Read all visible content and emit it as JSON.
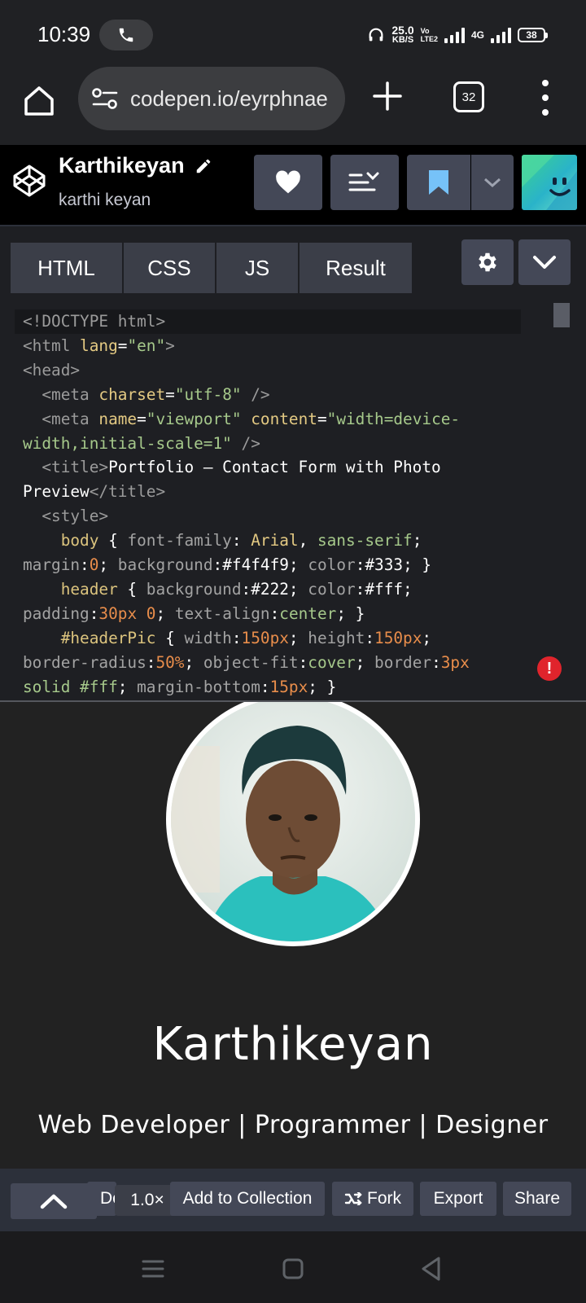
{
  "status_bar": {
    "time": "10:39",
    "net_speed_value": "25.0",
    "net_speed_unit": "KB/S",
    "volte_top": "Vo",
    "volte_bottom": "LTE2",
    "network": "4G",
    "battery": "38"
  },
  "browser": {
    "url": "codepen.io/eyrphnae",
    "tab_count": "32",
    "icons": [
      "home-icon",
      "site-settings-icon",
      "plus-icon",
      "tabs-icon",
      "more-vert-icon"
    ]
  },
  "pen": {
    "title": "Karthikeyan",
    "author": "karthi keyan"
  },
  "editor": {
    "tabs": [
      "HTML",
      "CSS",
      "JS",
      "Result"
    ],
    "code": {
      "l1": "<!DOCTYPE html>",
      "l2_open": "<html ",
      "l2_attr": "lang",
      "l2_eq": "=",
      "l2_val": "\"en\"",
      "l2_close": ">",
      "l3": "<head>",
      "l4_open": "  <meta ",
      "l4_attr": "charset",
      "l4_eq": "=",
      "l4_val": "\"utf-8\"",
      "l4_close": " />",
      "l5_open": "  <meta ",
      "l5_attr1": "name",
      "l5_eq1": "=",
      "l5_val1": "\"viewport\"",
      "l5_sp": " ",
      "l5_attr2": "content",
      "l5_eq2": "=",
      "l5_val2": "\"width=device-",
      "l6_val": "width,initial-scale=1\"",
      "l6_close": " />",
      "l7_open": "  <title>",
      "l7_text": "Portfolio — Contact Form with Photo",
      "l8_text": "Preview",
      "l8_close": "</title>",
      "l9": "  <style>",
      "l10_sel": "    body",
      "l10_a": " { ",
      "l10_prop": "font-family",
      "l10_b": ": ",
      "l10_v1": "Arial",
      "l10_c": ", ",
      "l10_v2": "sans-serif",
      "l10_d": ";",
      "l11_prop1": "margin",
      "l11_a": ":",
      "l11_num1": "0",
      "l11_b": "; ",
      "l11_prop2": "background",
      "l11_c": ":",
      "l11_v2": "#f4f4f9",
      "l11_d": "; ",
      "l11_prop3": "color",
      "l11_e": ":",
      "l11_v3": "#333",
      "l11_f": "; }",
      "l12_sel": "    header",
      "l12_a": " { ",
      "l12_prop1": "background",
      "l12_b": ":",
      "l12_v1": "#222",
      "l12_c": "; ",
      "l12_prop2": "color",
      "l12_d": ":",
      "l12_v2": "#fff",
      "l12_e": ";",
      "l13_prop1": "padding",
      "l13_a": ":",
      "l13_num1": "30px 0",
      "l13_b": "; ",
      "l13_prop2": "text-align",
      "l13_c": ":",
      "l13_v2": "center",
      "l13_d": "; }",
      "l14_sel": "    #headerPic",
      "l14_a": " { ",
      "l14_prop1": "width",
      "l14_b": ":",
      "l14_num1": "150px",
      "l14_c": "; ",
      "l14_prop2": "height",
      "l14_d": ":",
      "l14_num2": "150px",
      "l14_e": ";",
      "l15_prop1": "border-radius",
      "l15_a": ":",
      "l15_num1": "50%",
      "l15_b": "; ",
      "l15_prop2": "object-fit",
      "l15_c": ":",
      "l15_v2": "cover",
      "l15_d": "; ",
      "l15_prop3": "border",
      "l15_e": ":",
      "l15_num3": "3px",
      "l16_v": "solid #fff",
      "l16_a": "; ",
      "l16_prop": "margin-bottom",
      "l16_b": ":",
      "l16_num": "15px",
      "l16_c": "; }"
    },
    "error_mark": "!"
  },
  "result": {
    "name": "Karthikeyan",
    "tagline": "Web Developer | Programmer | Designer"
  },
  "toolbar": {
    "delete_label": "Delete",
    "zoom": "1.0×",
    "add_to_collection": "Add to Collection",
    "fork": "Fork",
    "export": "Export",
    "share": "Share"
  },
  "colors": {
    "codepen_button": "#444857",
    "editor_bg": "#1e1f23",
    "result_bg": "#222222",
    "bookmark_accent": "#47cf73",
    "error": "#e0242c"
  }
}
